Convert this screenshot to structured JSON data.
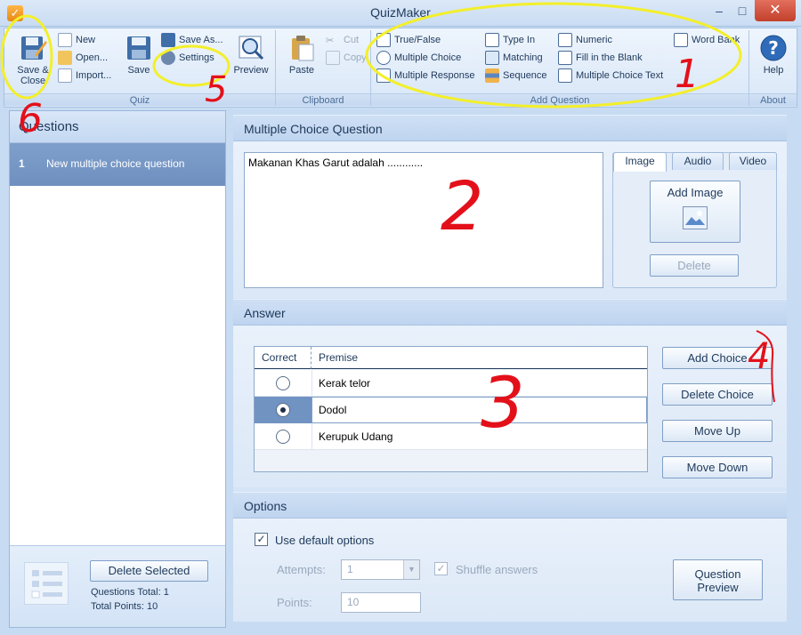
{
  "window": {
    "title": "QuizMaker",
    "minimize": "–",
    "maximize": "□",
    "close": "✕"
  },
  "ribbon": {
    "quiz": {
      "label": "Quiz",
      "save_close": "Save & Close",
      "new": "New",
      "open": "Open...",
      "import": "Import...",
      "save": "Save",
      "save_as": "Save As...",
      "settings": "Settings",
      "preview": "Preview"
    },
    "clipboard": {
      "label": "Clipboard",
      "paste": "Paste",
      "cut": "Cut",
      "copy": "Copy"
    },
    "add_question": {
      "label": "Add Question",
      "true_false": "True/False",
      "multiple_choice": "Multiple Choice",
      "multiple_response": "Multiple Response",
      "type_in": "Type In",
      "matching": "Matching",
      "sequence": "Sequence",
      "numeric": "Numeric",
      "fill_blank": "Fill in the Blank",
      "mc_text": "Multiple Choice Text",
      "word_bank": "Word Bank"
    },
    "about": {
      "label": "About",
      "help": "Help"
    }
  },
  "questions_panel": {
    "title": "Questions",
    "items": [
      {
        "num": "1",
        "title": "New multiple choice question"
      }
    ],
    "delete_selected": "Delete Selected",
    "total_questions": "Questions Total: 1",
    "total_points": "Total Points: 10"
  },
  "question": {
    "header": "Multiple Choice Question",
    "text": "Makanan Khas Garut adalah ............",
    "media_tabs": [
      "Image",
      "Audio",
      "Video"
    ],
    "add_image": "Add Image",
    "delete": "Delete"
  },
  "answer": {
    "header": "Answer",
    "col_correct": "Correct",
    "col_premise": "Premise",
    "rows": [
      {
        "premise": "Kerak telor",
        "correct": false
      },
      {
        "premise": "Dodol",
        "correct": true
      },
      {
        "premise": "Kerupuk Udang",
        "correct": false
      }
    ],
    "add_choice": "Add Choice",
    "delete_choice": "Delete Choice",
    "move_up": "Move Up",
    "move_down": "Move Down"
  },
  "options": {
    "header": "Options",
    "use_default": "Use default options",
    "attempts_label": "Attempts:",
    "attempts_value": "1",
    "shuffle": "Shuffle answers",
    "points_label": "Points:",
    "points_value": "10",
    "question_preview": "Question Preview"
  },
  "annotations": [
    "1",
    "2",
    "3",
    "4",
    "5",
    "6"
  ],
  "colors": {
    "annotation_yellow": "#f3ef2a",
    "annotation_red": "#e3101a",
    "selected_row": "#7193c2"
  }
}
